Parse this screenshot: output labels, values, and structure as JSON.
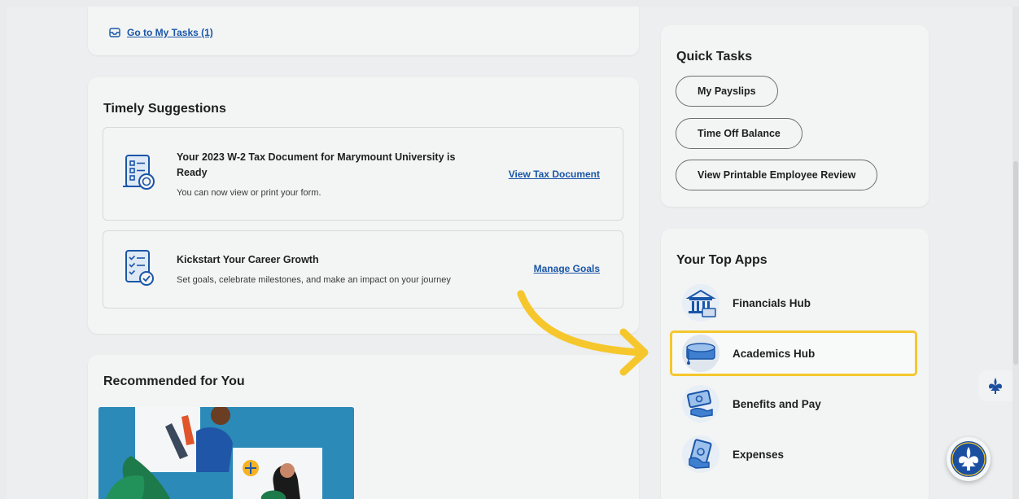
{
  "tasks": {
    "link_label": "Go to My Tasks (1)"
  },
  "timely": {
    "title": "Timely Suggestions",
    "items": [
      {
        "title": "Your 2023 W-2 Tax Document for Marymount University is Ready",
        "description": "You can now view or print your form.",
        "link": "View Tax Document",
        "icon": "tax-document-icon"
      },
      {
        "title": "Kickstart Your Career Growth",
        "description": "Set goals, celebrate milestones, and make an impact on your journey",
        "link": "Manage Goals",
        "icon": "checklist-icon"
      }
    ]
  },
  "recommended": {
    "title": "Recommended for You"
  },
  "quick_tasks": {
    "title": "Quick Tasks",
    "buttons": [
      "My Payslips",
      "Time Off Balance",
      "View Printable Employee Review"
    ]
  },
  "top_apps": {
    "title": "Your Top Apps",
    "apps": [
      {
        "label": "Financials Hub",
        "icon": "bank-icon"
      },
      {
        "label": "Academics Hub",
        "icon": "graduation-cap-icon",
        "highlighted": true
      },
      {
        "label": "Benefits and Pay",
        "icon": "money-hand-icon"
      },
      {
        "label": "Expenses",
        "icon": "cash-hand-icon"
      }
    ]
  },
  "colors": {
    "accent": "#1a56a8",
    "highlight": "#f5c72c",
    "brand": "#1b4fa0"
  }
}
